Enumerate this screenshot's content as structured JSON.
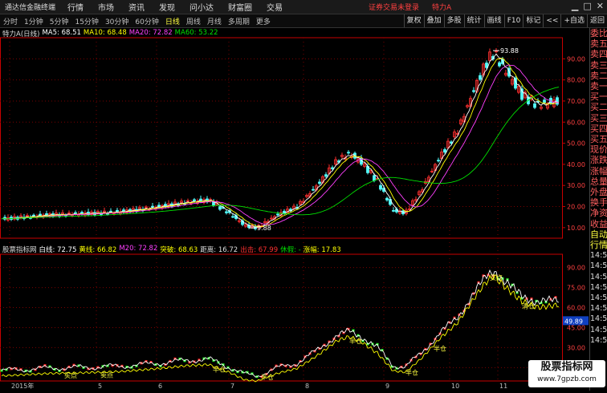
{
  "menubar": {
    "logo": "通达信金融终端",
    "items": [
      "行情",
      "市场",
      "资讯",
      "发现",
      "问小达",
      "财富圈",
      "交易"
    ],
    "status": "证券交易未登录",
    "stock": "特力A"
  },
  "toolbar": {
    "periods": [
      "分时",
      "1分钟",
      "5分钟",
      "15分钟",
      "30分钟",
      "60分钟",
      "日线",
      "周线",
      "月线",
      "多周期",
      "更多"
    ],
    "active": "日线",
    "right_tools": [
      "复权",
      "叠加",
      "多股",
      "统计",
      "画线",
      "F10",
      "标记",
      "<<",
      "+自选",
      "返回"
    ]
  },
  "main_legend": {
    "title": "特力A(日线)",
    "ma5": "MA5: 68.51",
    "ma10": "MA10: 68.48",
    "ma20": "MA20: 72.82",
    "ma60": "MA60: 53.22"
  },
  "indicator_legend": {
    "title": "股票指标网",
    "white": "白线: 72.75",
    "yellow": "黄线: 66.82",
    "m20": "M20: 72.82",
    "breakout": "突破: 68.63",
    "distance": "距离: 16.72",
    "exit": "出击: 67.99",
    "rest": "休假: -",
    "gain": "涨幅: 17.83"
  },
  "colors": {
    "up": "#ff3030",
    "down": "#54fcfc",
    "ma5": "#ffffff",
    "ma10": "#ffff00",
    "ma20": "#ff40ff",
    "ma60": "#00e000",
    "grid": "#7a0000",
    "axis": "#c80000"
  },
  "main_axis": {
    "labels": [
      "90.00",
      "80.00",
      "70.00",
      "60.00",
      "50.00",
      "40.00",
      "30.00",
      "20.00",
      "10.00"
    ],
    "min": 5,
    "max": 100
  },
  "indicator_axis": {
    "labels": [
      "90.00",
      "75.00",
      "60.00",
      "45.00",
      "30.00",
      "15.00"
    ],
    "min": 5,
    "max": 100,
    "current": "49.89"
  },
  "annotations": {
    "high": "93.88",
    "low": "9.88"
  },
  "indicator_signals": [
    "买点",
    "卖点",
    "半仓",
    "半仓",
    "半仓",
    "半仓",
    "半仓",
    "买点",
    "清仓"
  ],
  "xaxis": [
    "2015年",
    "5",
    "6",
    "7",
    "8",
    "9",
    "10",
    "11"
  ],
  "sidepanel": {
    "order_labels": [
      "委比",
      "卖五",
      "卖四",
      "卖三",
      "卖二",
      "卖一",
      "买一",
      "买二",
      "买三",
      "买四",
      "买五",
      "现价",
      "涨跌",
      "涨幅",
      "总量",
      "外盘",
      "换手",
      "净资",
      "收益"
    ],
    "bottom_labels": [
      "自动",
      "行情"
    ],
    "times": [
      "14:50",
      "14:50",
      "14:50",
      "14:50",
      "14:50",
      "14:50",
      "14:50",
      "14:50",
      "14:51"
    ]
  },
  "watermark": {
    "title": "股票指标网",
    "url": "www.7gpzb.com"
  }
}
